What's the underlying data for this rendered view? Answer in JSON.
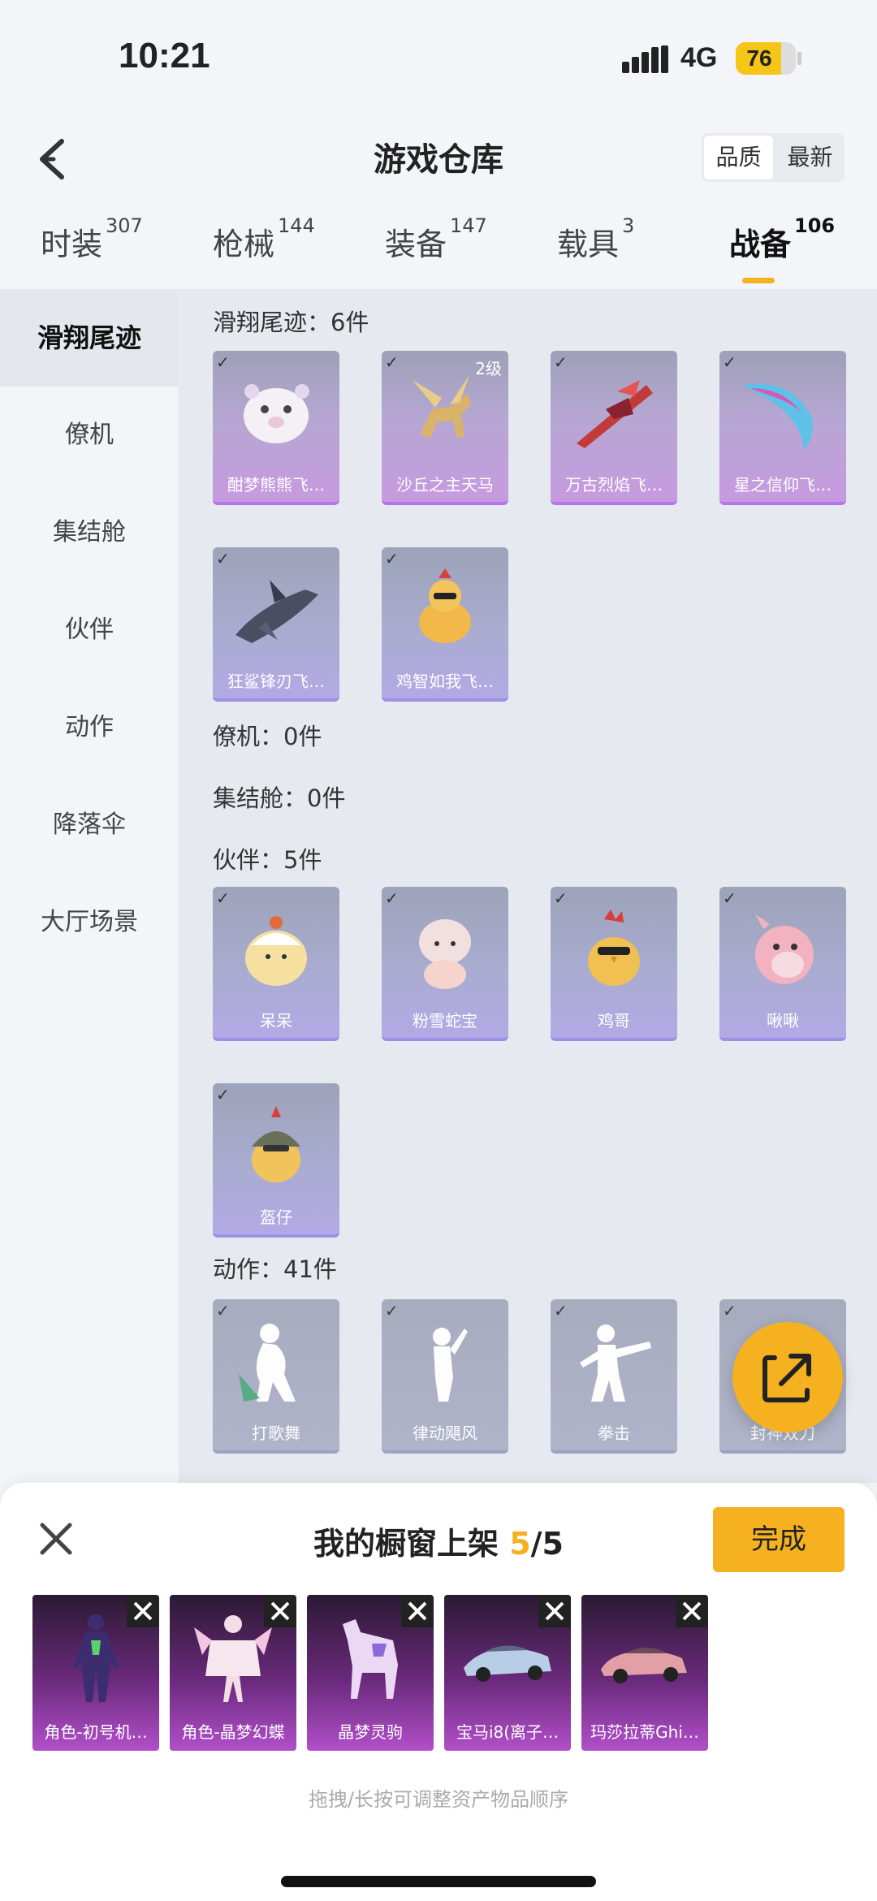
{
  "status": {
    "time": "10:21",
    "network": "4G",
    "battery": "76",
    "battery_level_percent": 76
  },
  "header": {
    "title": "游戏仓库",
    "sort_quality": "品质",
    "sort_newest": "最新"
  },
  "tabs": [
    {
      "label": "时装",
      "count": "307"
    },
    {
      "label": "枪械",
      "count": "144"
    },
    {
      "label": "装备",
      "count": "147"
    },
    {
      "label": "载具",
      "count": "3"
    },
    {
      "label": "战备",
      "count": "106"
    }
  ],
  "sidebar": [
    "滑翔尾迹",
    "僚机",
    "集结舱",
    "伙伴",
    "动作",
    "降落伞",
    "大厅场景"
  ],
  "sections": {
    "glide": {
      "title": "滑翔尾迹：6件",
      "items": [
        "酣梦熊熊飞…",
        "沙丘之主天马",
        "万古烈焰飞…",
        "星之信仰飞…",
        "狂鲨锋刃飞…",
        "鸡智如我飞…"
      ],
      "level": "2级"
    },
    "wingman": {
      "title": "僚机：0件"
    },
    "pod": {
      "title": "集结舱：0件"
    },
    "partner": {
      "title": "伙伴：5件",
      "items": [
        "呆呆",
        "粉雪蛇宝",
        "鸡哥",
        "啾啾",
        "盔仔"
      ]
    },
    "emote": {
      "title": "动作：41件",
      "items": [
        "打歌舞",
        "律动飓风",
        "拳击",
        "封神双刀"
      ]
    }
  },
  "sheet": {
    "title_prefix": "我的橱窗上架 ",
    "count": "5",
    "total": "/5",
    "done": "完成",
    "items": [
      "角色-初号机…",
      "角色-晶梦幻蝶",
      "晶梦灵驹",
      "宝马i8(离子…",
      "玛莎拉蒂Ghi…"
    ],
    "hint": "拖拽/长按可调整资产物品顺序"
  },
  "icons": [
    "back-chevron-icon",
    "check-icon",
    "share-icon",
    "close-icon",
    "remove-icon"
  ]
}
